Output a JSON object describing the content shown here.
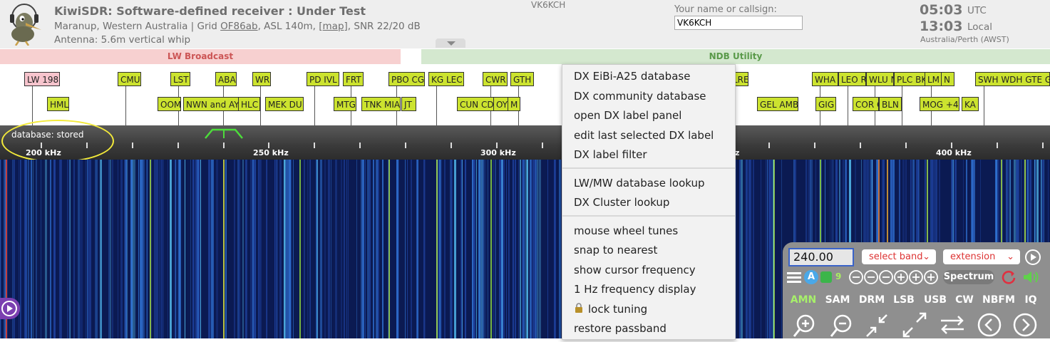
{
  "header": {
    "title": "KiwiSDR: Software-defined receiver : Under Test",
    "subtitle_prefix": "Maranup, Western Australia | Grid ",
    "grid": "OF86ab",
    "subtitle_mid": ", ASL 140m, [",
    "map_link": "map",
    "subtitle_suffix": "], SNR 22/20 dB",
    "antenna": "Antenna: 5.6m vertical whip",
    "center_callsign": "VK6KCH",
    "name_label": "Your name or callsign:",
    "name_value": "VK6KCH",
    "utc_time": "05:03",
    "utc_label": "UTC",
    "local_time": "13:03",
    "local_label": "Local",
    "timezone": "Australia/Perth (AWST)"
  },
  "bands": {
    "lw": "LW Broadcast",
    "ndb": "NDB Utility"
  },
  "dx_labels_row1": [
    "LW 198",
    "CMU",
    "LST",
    "ABA",
    "WR",
    "PD IVL",
    "FRT",
    "PBO CG",
    "KG LEC",
    "CWR",
    "GTH",
    "LRE",
    "WHA",
    "LEO R",
    "WLU N",
    "PLC BK",
    "LM",
    "N",
    "SWH WDH GTE GL"
  ],
  "dx_labels_row2": [
    "HML",
    "OOM",
    "NWN and AY",
    "HLC",
    "MEK DU",
    "MTG",
    "TNK MIA",
    "JT",
    "CUN CD",
    "OY",
    "M",
    "GEL AMB",
    "GIG",
    "COR G",
    "BLN",
    "MOG +4",
    "KA"
  ],
  "scale": {
    "db_status": "database: stored",
    "marks": [
      "200 kHz",
      "250 kHz",
      "300 kHz",
      "z",
      "400 kHz"
    ]
  },
  "context_menu": {
    "group1": [
      "DX EiBi-A25 database",
      "DX community database",
      "open DX label panel",
      "edit last selected DX label",
      "DX label filter"
    ],
    "group2": [
      "LW/MW database lookup",
      "DX Cluster lookup"
    ],
    "group3": [
      "mouse wheel tunes",
      "snap to nearest",
      "show cursor frequency",
      "1 Hz frequency display",
      "lock tuning",
      "restore passband"
    ]
  },
  "control_panel": {
    "frequency": "240.00",
    "select_band": "select band",
    "extension": "extension",
    "agc_letter": "A",
    "step_number": "9",
    "spectrum_label": "Spectrum",
    "modes": [
      "AMN",
      "SAM",
      "DRM",
      "LSB",
      "USB",
      "CW",
      "NBFM",
      "IQ"
    ],
    "active_mode": "AMN"
  },
  "colors": {
    "dx_label": "#cce32f",
    "dx_label_pink": "#f7c4cd",
    "lw_band": "#f7d0d0",
    "ndb_band": "#d4e8cf",
    "panel": "#8f8f8f",
    "active_mode": "#a7f06a"
  },
  "icons": [
    "kiwi-bird-logo-icon",
    "chevron-down-icon",
    "play-icon",
    "hamburger-menu-icon",
    "agc-icon",
    "mute-icon",
    "zoom-in-icon",
    "zoom-out-icon",
    "minimize-icon",
    "maximize-icon",
    "swap-icon",
    "arrow-left-icon",
    "arrow-right-icon",
    "lock-icon",
    "refresh-icon",
    "speaker-icon"
  ]
}
